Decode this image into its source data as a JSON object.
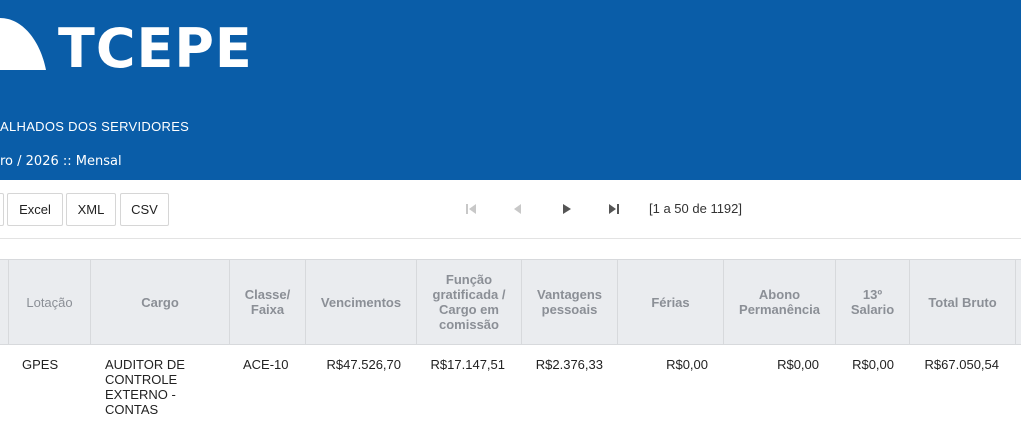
{
  "header": {
    "logo_text": "TCEPE",
    "report_title": "ALHADOS DOS SERVIDORES",
    "period": "ro / 2026 :: Mensal"
  },
  "toolbar": {
    "export_buttons": [
      "Excel",
      "XML",
      "CSV"
    ],
    "pager": {
      "first_icon": "first-page-icon",
      "prev_icon": "prev-page-icon",
      "next_icon": "next-page-icon",
      "last_icon": "last-page-icon",
      "info": "[1 a 50 de 1192]"
    }
  },
  "table": {
    "columns": [
      "Lotação",
      "Cargo",
      "Classe/ Faixa",
      "Vencimentos",
      "Função gratificada / Cargo em comissão",
      "Vantagens pessoais",
      "Férias",
      "Abono Permanência",
      "13º Salario",
      "Total Bruto"
    ],
    "rows": [
      {
        "lotacao": "GPES",
        "cargo": "AUDITOR DE CONTROLE EXTERNO - CONTAS",
        "classe": "ACE-10",
        "vencimentos": "R$47.526,70",
        "funcao": "R$17.147,51",
        "vantagens": "R$2.376,33",
        "ferias": "R$0,00",
        "abono": "R$0,00",
        "decimo": "R$0,00",
        "total": "R$67.050,54"
      }
    ]
  },
  "colors": {
    "header_bg": "#0a5da8",
    "table_header_bg": "#eaecef",
    "table_header_text": "#8b8f96"
  }
}
